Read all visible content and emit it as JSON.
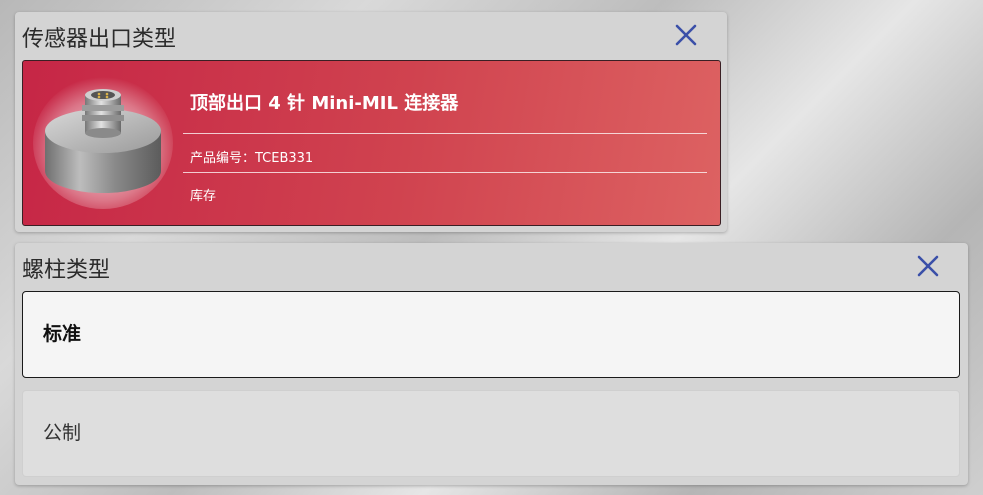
{
  "sensor_output_panel": {
    "title": "传感器出口类型",
    "close_icon": "close-icon",
    "selected_option": {
      "title": "顶部出口 4 针 Mini-MIL 连接器",
      "part_number": "产品编号：TCEB331",
      "stock": "库存",
      "image": "connector-product-image",
      "colors": {
        "gradient_start": "#c62646",
        "gradient_end": "#dd6262"
      }
    }
  },
  "stud_type_panel": {
    "title": "螺柱类型",
    "close_icon": "close-icon",
    "options": [
      {
        "label": "标准",
        "selected": true
      },
      {
        "label": "公制",
        "selected": false
      }
    ]
  },
  "colors": {
    "close_icon": "#3a4fa8",
    "panel_bg": "#d4d4d4"
  }
}
